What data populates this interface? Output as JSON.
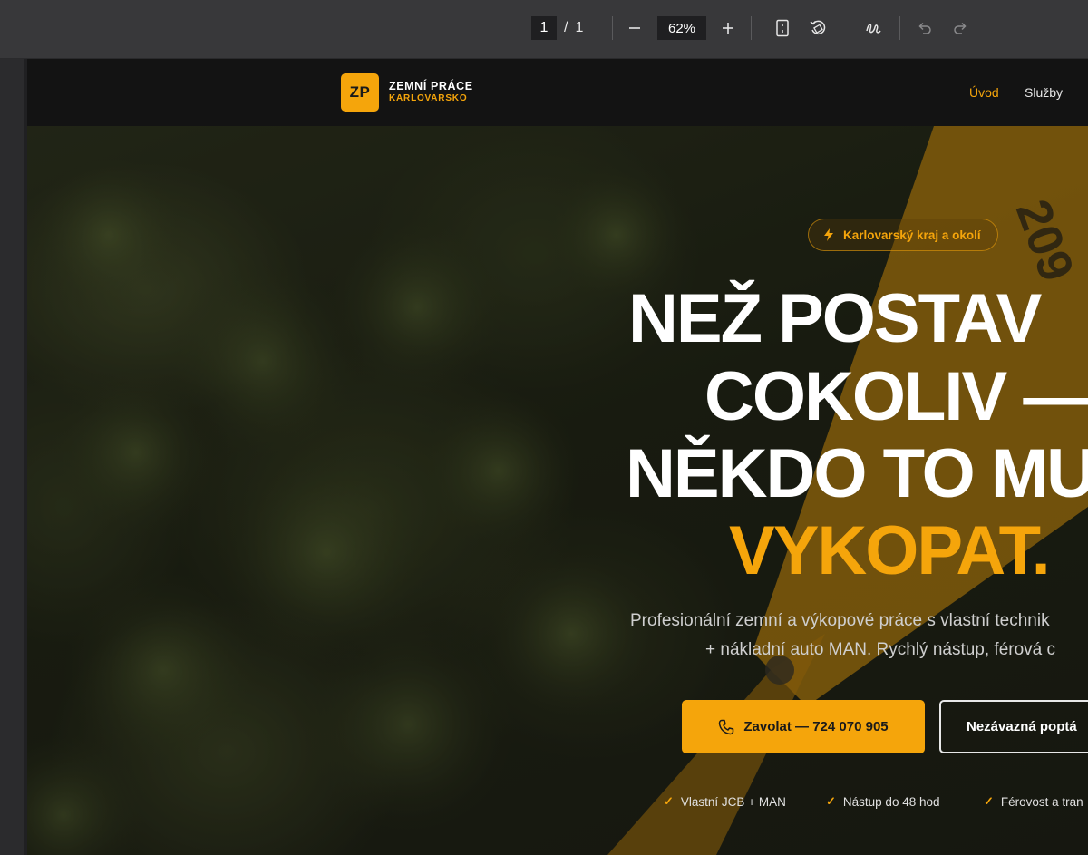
{
  "viewer": {
    "current_page": "1",
    "page_separator": "/",
    "total_pages": "1",
    "zoom": "62%",
    "icons": [
      "minus-icon",
      "plus-icon",
      "fit-page-icon",
      "rotate-icon",
      "draw-icon",
      "undo-icon",
      "redo-icon"
    ]
  },
  "site": {
    "logo_mark": "ZP",
    "logo_title": "ZEMNÍ PRÁCE",
    "logo_subtitle": "KARLOVARSKO",
    "nav": [
      {
        "label": "Úvod",
        "active": true
      },
      {
        "label": "Služby",
        "active": false
      }
    ]
  },
  "hero": {
    "badge": "Karlovarský kraj a okolí",
    "headline_lines": [
      "NEŽ POSTAV",
      "COKOLIV —",
      "NĚKDO TO MU",
      "VYKOPAT."
    ],
    "subtitle_lines": [
      "Profesionální zemní a výkopové práce s vlastní technik",
      "+ nákladní auto MAN. Rychlý nástup, férová c"
    ],
    "primary_button": "Zavolat — 724 070 905",
    "secondary_button": "Nezávazná poptá",
    "features": [
      "Vlastní JCB + MAN",
      "Nástup do 48 hod",
      "Férovost a tran"
    ]
  },
  "colors": {
    "accent": "#f5a50b",
    "header_bg": "#131313",
    "toolbar_bg": "#38383a"
  }
}
